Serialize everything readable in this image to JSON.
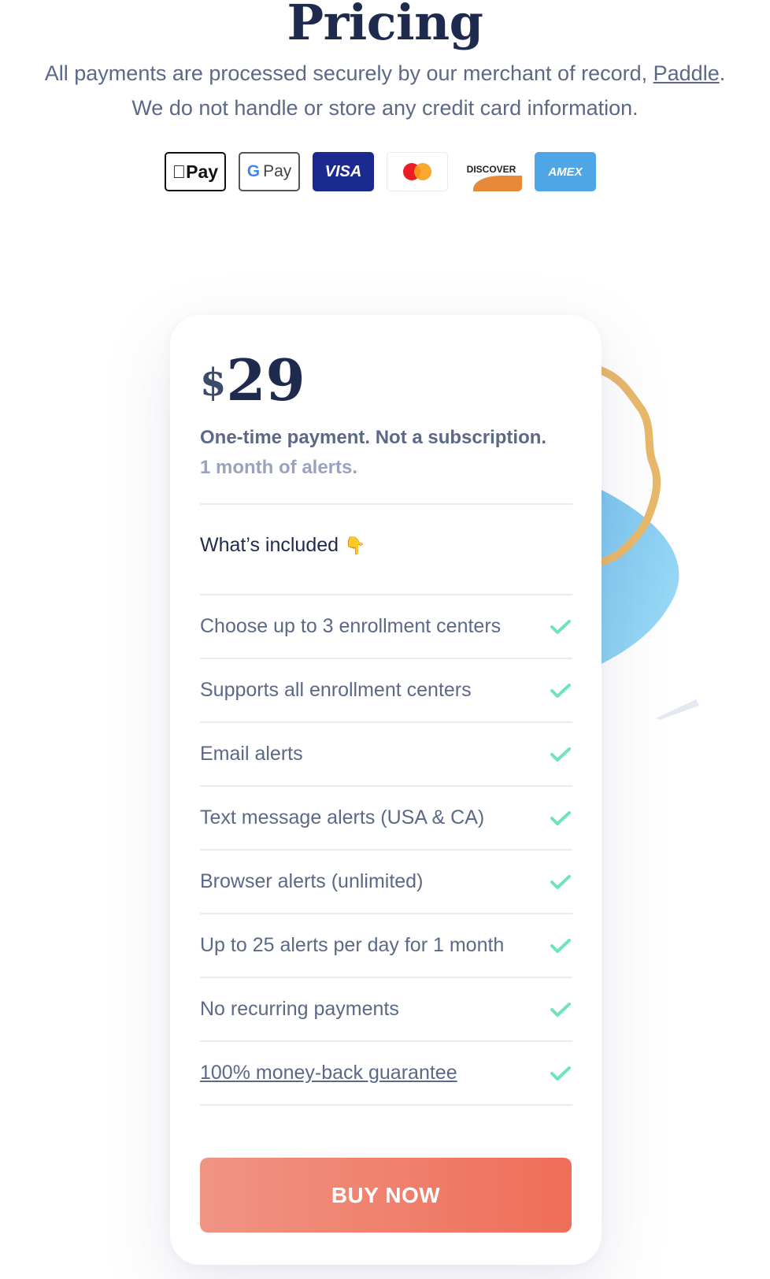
{
  "header": {
    "title": "Pricing",
    "line1_text": "All payments are processed securely by our merchant of record,",
    "line1_link": "Paddle",
    "line1_end": ".",
    "line2_text": "We do not handle or store any credit card information."
  },
  "payment_methods": [
    {
      "name": "Apple Pay",
      "label": "Pay"
    },
    {
      "name": "Google Pay",
      "label": "G Pay"
    },
    {
      "name": "Visa",
      "label": "VISA"
    },
    {
      "name": "Mastercard",
      "label": ""
    },
    {
      "name": "Discover",
      "label": "DISCOVER"
    },
    {
      "name": "American Express",
      "label": "AMEX"
    }
  ],
  "plan": {
    "currency": "$",
    "price": "29",
    "note": "One-time payment. Not a subscription.",
    "duration": "1 month of alerts.",
    "included_title": "What’s included",
    "included_icon": "👇",
    "features": [
      "Choose up to 3 enrollment centers",
      "Supports all enrollment centers",
      "Email alerts",
      "Text message alerts (USA & CA)",
      "Browser alerts (unlimited)",
      "Up to 25 alerts per day for 1 month",
      "No recurring payments",
      "100% money-back guarantee"
    ],
    "cta": "BUY NOW"
  },
  "colors": {
    "heading": "#1e2b4f",
    "body_text": "#5b6987",
    "check": "#6fe3c1",
    "cta_start": "#f09484",
    "cta_end": "#ef6e58"
  }
}
